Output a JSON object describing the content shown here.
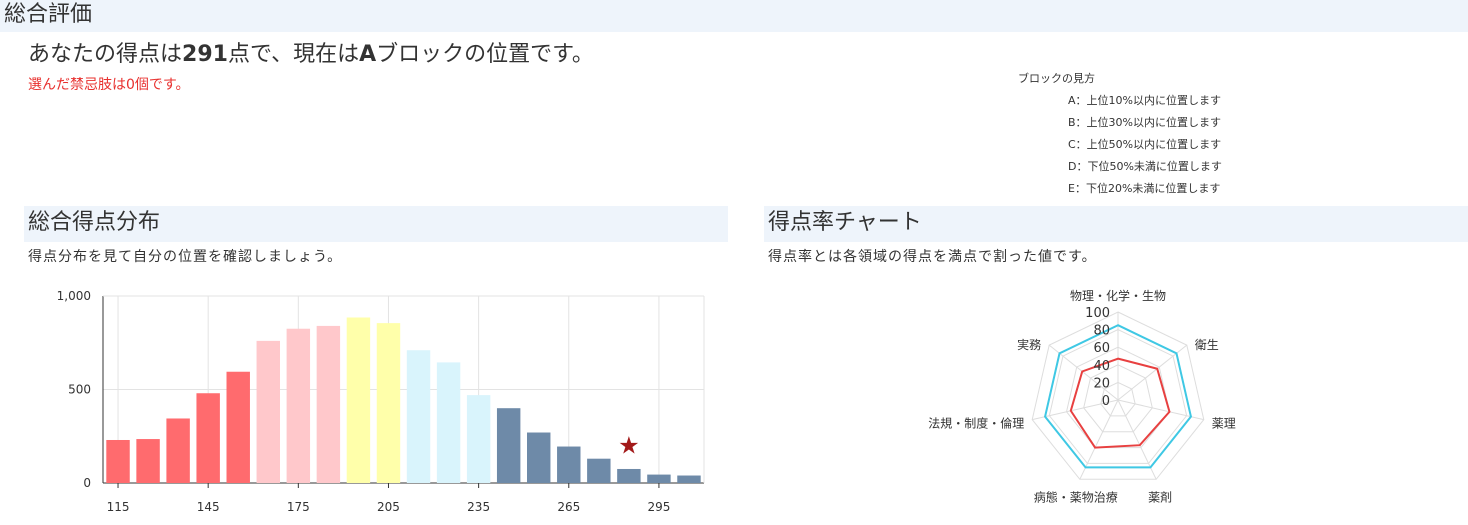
{
  "header": {
    "title": "総合評価"
  },
  "summary": {
    "prefix": "あなたの得点は",
    "score": "291",
    "middle": "点で、現在は",
    "block": "A",
    "suffix": "ブロックの位置です。",
    "forbidden": "選んだ禁忌肢は0個です。"
  },
  "block_legend": {
    "title": "ブロックの見方",
    "items": [
      "A：上位10%以内に位置します",
      "B：上位30%以内に位置します",
      "C：上位50%以内に位置します",
      "D：下位50%未満に位置します",
      "E：下位20%未満に位置します"
    ]
  },
  "sections": {
    "distribution": {
      "title": "総合得点分布",
      "subtitle": "得点分布を見て自分の位置を確認しましょう。"
    },
    "rate": {
      "title": "得点率チャート",
      "subtitle": "得点率とは各領域の得点を満点で割った値です。"
    }
  },
  "chart_data": [
    {
      "type": "bar",
      "x": [
        115,
        125,
        135,
        145,
        155,
        165,
        175,
        185,
        195,
        205,
        215,
        225,
        235,
        245,
        255,
        265,
        275,
        285,
        295,
        305
      ],
      "values": [
        230,
        235,
        345,
        480,
        595,
        760,
        825,
        840,
        885,
        855,
        710,
        645,
        470,
        400,
        270,
        195,
        130,
        75,
        45,
        40
      ],
      "colors": [
        "#ff6b6e",
        "#ff6b6e",
        "#ff6b6e",
        "#ff6b6e",
        "#ff6b6e",
        "#ffc8cb",
        "#ffc8cb",
        "#ffc8cb",
        "#ffffaa",
        "#ffffaa",
        "#d9f4fc",
        "#d9f4fc",
        "#d9f4fc",
        "#6e8aa8",
        "#6e8aa8",
        "#6e8aa8",
        "#6e8aa8",
        "#6e8aa8",
        "#6e8aa8",
        "#6e8aa8"
      ],
      "xticks": [
        "115",
        "145",
        "175",
        "205",
        "235",
        "265",
        "295"
      ],
      "yticks": [
        "0",
        "500",
        "1,000"
      ],
      "ylim": [
        0,
        1000
      ],
      "marker": {
        "x": 285,
        "value": 200,
        "symbol": "★",
        "color": "#a31a1a"
      },
      "grid": true
    },
    {
      "type": "radar",
      "categories": [
        "物理・化学・生物",
        "衛生",
        "薬理",
        "薬剤",
        "病態・薬物治療",
        "法規・制度・倫理",
        "実務"
      ],
      "rlim": [
        0,
        100
      ],
      "rticks": [
        "0",
        "20",
        "40",
        "60",
        "80",
        "100"
      ],
      "series": [
        {
          "values": [
            85,
            85,
            85,
            85,
            85,
            85,
            85
          ],
          "color": "#3fc8e4"
        },
        {
          "values": [
            47,
            57,
            60,
            57,
            60,
            55,
            52
          ],
          "color": "#e84040"
        }
      ]
    }
  ]
}
